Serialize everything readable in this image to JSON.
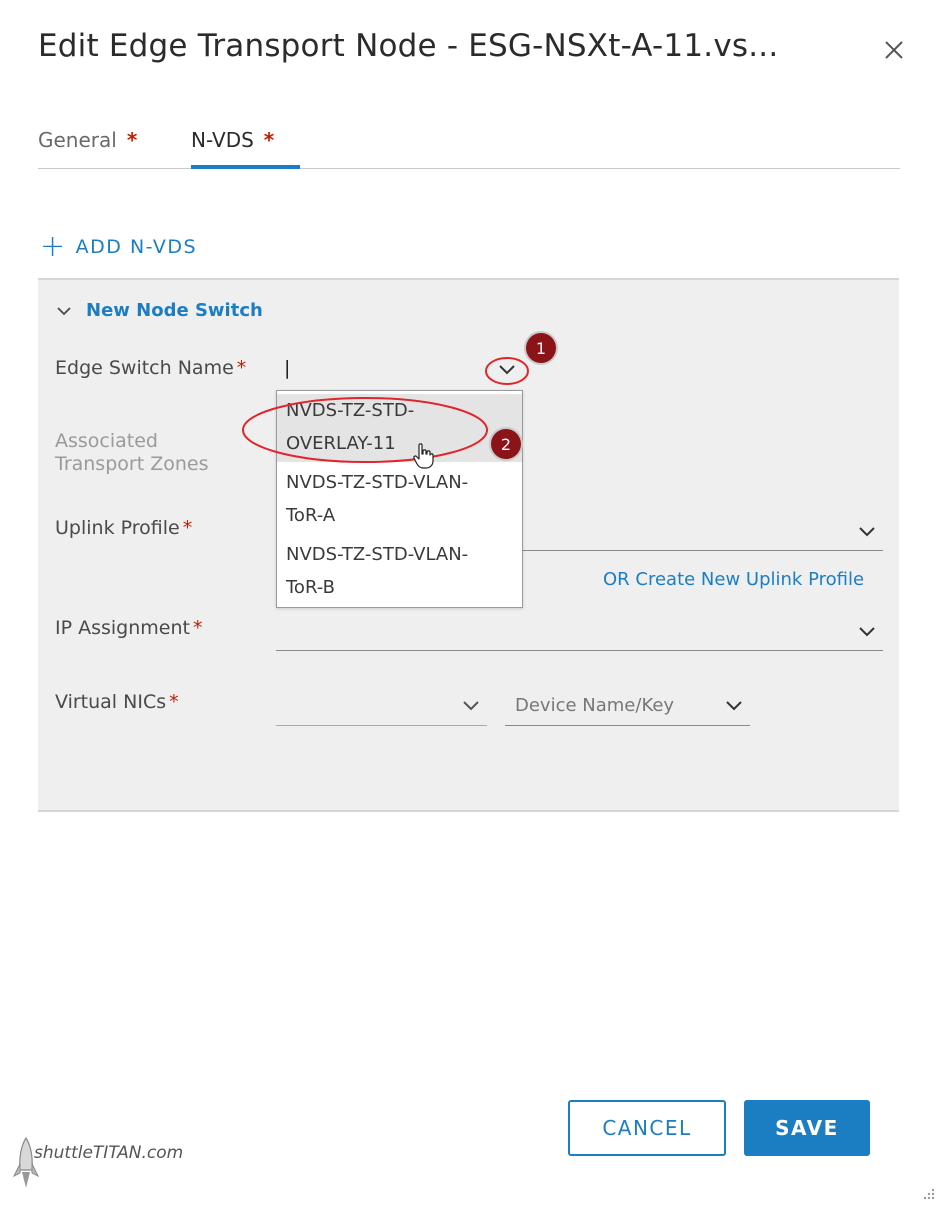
{
  "dialog": {
    "title": "Edit Edge Transport Node - ESG-NSXt-A-11.vs...",
    "tabs": [
      {
        "label": "General",
        "required": "*"
      },
      {
        "label": "N-VDS",
        "required": "*"
      }
    ],
    "add_nvds_label": "ADD N-VDS",
    "section_title": "New Node Switch"
  },
  "form": {
    "edge_switch_name": {
      "label": "Edge Switch Name",
      "required": "*",
      "value": "|"
    },
    "associated_transport_zones": {
      "label_line1": "Associated",
      "label_line2": "Transport Zones"
    },
    "uplink_profile": {
      "label": "Uplink Profile",
      "required": "*",
      "create_link": "OR Create New Uplink Profile"
    },
    "ip_assignment": {
      "label": "IP Assignment",
      "required": "*"
    },
    "virtual_nics": {
      "label": "Virtual NICs",
      "required": "*",
      "device_placeholder": "Device Name/Key"
    }
  },
  "dropdown": {
    "options": [
      {
        "line1": "NVDS-TZ-STD-",
        "line2": "OVERLAY-11"
      },
      {
        "line1": "NVDS-TZ-STD-VLAN-",
        "line2": "ToR-A"
      },
      {
        "line1": "NVDS-TZ-STD-VLAN-",
        "line2": "ToR-B"
      }
    ]
  },
  "annotations": {
    "step1": "1",
    "step2": "2"
  },
  "buttons": {
    "cancel": "CANCEL",
    "save": "SAVE"
  },
  "watermark": "shuttleTITAN.com",
  "colors": {
    "accent": "#1b7ec2",
    "required": "#c21d00",
    "annotation_red": "#e0262b",
    "badge": "#8b1418"
  }
}
